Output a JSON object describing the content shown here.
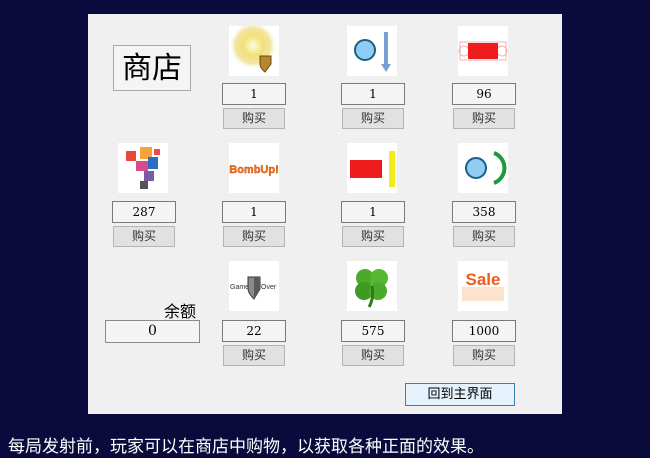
{
  "shop": {
    "title": "商店",
    "items": [
      {
        "icon": "explosion-shield-icon",
        "count": "1",
        "buy_label": "购买"
      },
      {
        "icon": "ball-arrow-down-icon",
        "count": "1",
        "buy_label": "购买"
      },
      {
        "icon": "red-paddle-icon",
        "count": "96",
        "buy_label": "购买"
      },
      {
        "icon": "color-blocks-icon",
        "count": "287",
        "buy_label": "购买"
      },
      {
        "icon": "bombup-icon",
        "text": "BombUp!",
        "count": "1",
        "buy_label": "购买"
      },
      {
        "icon": "red-block-yellow-bar-icon",
        "count": "1",
        "buy_label": "购买"
      },
      {
        "icon": "ball-green-arc-icon",
        "count": "358",
        "buy_label": "购买"
      },
      {
        "icon": "game-over-shield-icon",
        "text_left": "Game",
        "text_right": "Over",
        "count": "22",
        "buy_label": "购买"
      },
      {
        "icon": "four-leaf-clover-icon",
        "count": "575",
        "buy_label": "购买"
      },
      {
        "icon": "sale-icon",
        "text": "Sale",
        "count": "1000",
        "buy_label": "购买"
      }
    ],
    "balance_label": "余额",
    "balance_value": "0",
    "back_button": "回到主界面"
  },
  "caption": "每局发射前，玩家可以在商店中购物，以获取各种正面的效果。",
  "colors": {
    "background": "#0a0a3c",
    "panel": "#f0f0f0",
    "back_button_border": "#3c7fb1"
  }
}
